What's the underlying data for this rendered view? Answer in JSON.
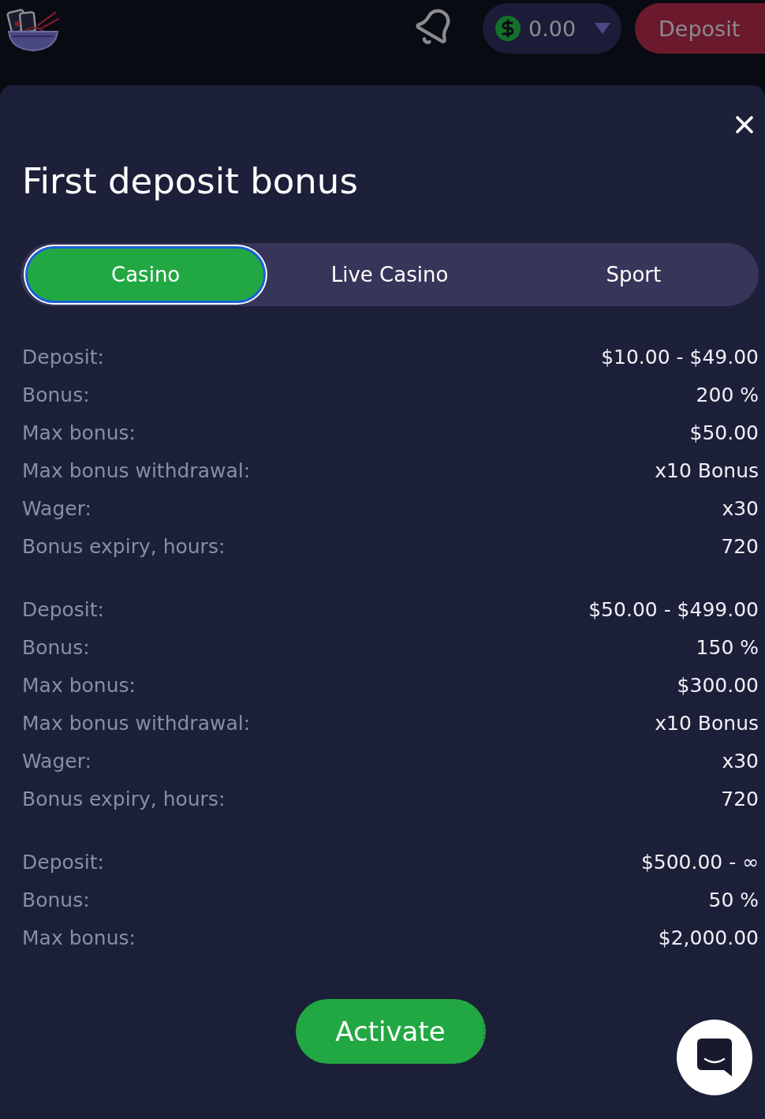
{
  "header": {
    "balance": "0.00",
    "deposit_button": "Deposit"
  },
  "modal": {
    "title": "First deposit bonus",
    "tabs": [
      {
        "label": "Casino",
        "selected": true
      },
      {
        "label": "Live Casino",
        "selected": false
      },
      {
        "label": "Sport",
        "selected": false
      }
    ],
    "tiers": [
      {
        "rows": [
          {
            "label": "Deposit:",
            "value": "$10.00 - $49.00"
          },
          {
            "label": "Bonus:",
            "value": "200 %"
          },
          {
            "label": "Max bonus:",
            "value": "$50.00"
          },
          {
            "label": "Max bonus withdrawal:",
            "value": "x10 Bonus"
          },
          {
            "label": "Wager:",
            "value": "x30"
          },
          {
            "label": "Bonus expiry, hours:",
            "value": "720"
          }
        ]
      },
      {
        "rows": [
          {
            "label": "Deposit:",
            "value": "$50.00 - $499.00"
          },
          {
            "label": "Bonus:",
            "value": "150 %"
          },
          {
            "label": "Max bonus:",
            "value": "$300.00"
          },
          {
            "label": "Max bonus withdrawal:",
            "value": "x10 Bonus"
          },
          {
            "label": "Wager:",
            "value": "x30"
          },
          {
            "label": "Bonus expiry, hours:",
            "value": "720"
          }
        ]
      },
      {
        "rows": [
          {
            "label": "Deposit:",
            "value": "$500.00 - ∞"
          },
          {
            "label": "Bonus:",
            "value": "50 %"
          },
          {
            "label": "Max bonus:",
            "value": "$2,000.00"
          }
        ]
      }
    ],
    "activate_button": "Activate"
  }
}
